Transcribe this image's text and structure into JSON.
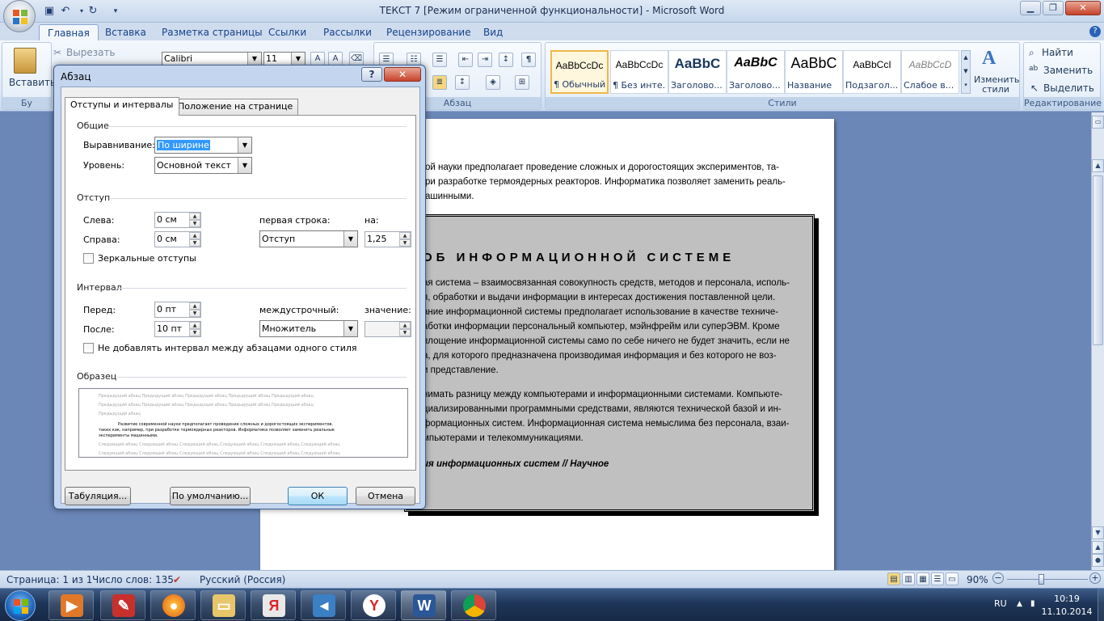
{
  "window": {
    "title": "ТЕКСТ 7 [Режим ограниченной функциональности] - Microsoft Word"
  },
  "ribbon": {
    "tabs": [
      "Главная",
      "Вставка",
      "Разметка страницы",
      "Ссылки",
      "Рассылки",
      "Рецензирование",
      "Вид"
    ],
    "active_tab": "Главная",
    "clipboard": {
      "paste_label": "Вставить",
      "cut_label": "Вырезать",
      "group_label_partial": "Бу"
    },
    "font": {
      "name": "Calibri",
      "size": "11"
    },
    "paragraph_group_label": "Абзац",
    "styles_group_label": "Стили",
    "styles": [
      {
        "sample": "AaBbCcDc",
        "name": "¶ Обычный",
        "active": true
      },
      {
        "sample": "AaBbCcDc",
        "name": "¶ Без инте..."
      },
      {
        "sample": "AaBbC",
        "name": "Заголово..."
      },
      {
        "sample": "AaBbC",
        "name": "Заголово..."
      },
      {
        "sample": "AaBbC",
        "name": "Название"
      },
      {
        "sample": "AaBbCcI",
        "name": "Подзагол..."
      },
      {
        "sample": "AaBbCcD",
        "name": "Слабое в..."
      }
    ],
    "change_styles_label": "Изменить стили",
    "editing_group_label": "Редактирование",
    "find_label": "Найти",
    "replace_label": "Заменить",
    "select_label": "Выделить"
  },
  "document": {
    "top_lines": [
      "ой науки предполагает проведение сложных и дорогостоящих экспериментов, та-",
      "ри разработке термоядерных реакторов. Информатика позволяет заменить реаль-",
      "ашинными."
    ],
    "box_title": "ОБ ИНФОРМАЦИОННОЙ СИСТЕМЕ",
    "box_lines": [
      "ая система – взаимосвязанная совокупность средств, методов и персонала, исполь-",
      "я, обработки и выдачи информации в интересах достижения поставленной цели.",
      "ание информационной системы предполагает использование в качестве техниче-",
      "аботки информации персональный компьютер, мэйнфрейм или суперЭВМ. Кроме",
      "площение информационной системы само по себе ничего не будет значить, если не",
      "а, для которого предназначена производимая информация и без которого не воз-",
      "и представление.",
      "нимать разницу между компьютерами и информационными системами. Компьюте-",
      "циализированными программными средствами, являются технической базой и ин-",
      "формационных систем. Информационная система немыслима без персонала, взаи-",
      "мпьютерами и телекоммуникациями."
    ],
    "box_citation": "ия информационных систем // Научное"
  },
  "dialog": {
    "title": "Абзац",
    "help_label": "?",
    "close_label": "✕",
    "tabs": [
      "Отступы и интервалы",
      "Положение на странице"
    ],
    "general": {
      "title": "Общие",
      "alignment_label": "Выравнивание:",
      "alignment_value": "По ширине",
      "level_label": "Уровень:",
      "level_value": "Основной текст"
    },
    "indent": {
      "title": "Отступ",
      "left_label": "Слева:",
      "left_value": "0 см",
      "right_label": "Справа:",
      "right_value": "0 см",
      "first_line_label": "первая строка:",
      "first_line_value": "Отступ",
      "by_label": "на:",
      "by_value": "1,25",
      "mirror_label": "Зеркальные отступы"
    },
    "spacing": {
      "title": "Интервал",
      "before_label": "Перед:",
      "before_value": "0 пт",
      "after_label": "После:",
      "after_value": "10 пт",
      "line_label": "междустрочный:",
      "line_value": "Множитель",
      "at_label": "значение:",
      "at_value": "",
      "no_space_label": "Не добавлять интервал между абзацами одного стиля"
    },
    "preview": {
      "title": "Образец",
      "prev_text": "Предыдущий абзац Предыдущий абзац Предыдущий абзац Предыдущий абзац Предыдущий абзац",
      "prev_text_short": "Предыдущий абзац",
      "sample_lines": [
        "Развитие современной науки предполагает проведение сложных и дорогостоящих экспериментов,",
        "таких как, например, при разработке термоядерных реакторов. Информатика позволяет заменить реальные",
        "эксперименты машинными."
      ],
      "next_text": "Следующий абзац Следующий абзац Следующий абзац Следующий абзац Следующий абзац Следующий абзац"
    },
    "buttons": {
      "tabs": "Табуляция...",
      "default": "По умолчанию...",
      "ok": "ОК",
      "cancel": "Отмена"
    }
  },
  "statusbar": {
    "page": "Страница: 1 из 1",
    "words": "Число слов: 135",
    "language": "Русский (Россия)",
    "zoom": "90%"
  },
  "taskbar": {
    "lang": "RU",
    "time": "10:19",
    "date": "11.10.2014"
  }
}
